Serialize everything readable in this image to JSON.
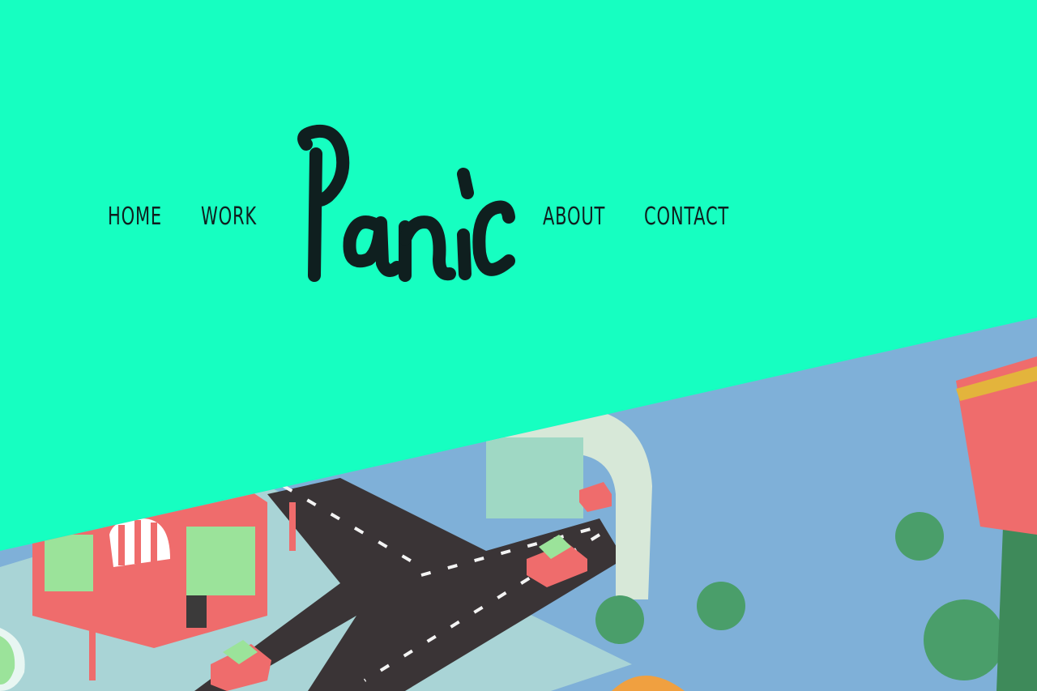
{
  "nav": {
    "items": [
      {
        "label": "HOME"
      },
      {
        "label": "WORK"
      },
      {
        "label": "ABOUT"
      },
      {
        "label": "CONTACT"
      }
    ]
  },
  "logo": {
    "text": "Panic"
  },
  "colors": {
    "background": "#16ffc1",
    "text": "#0f1f1f",
    "road": "#3a3436",
    "ground": "#7fb0d8",
    "building": "#ef6c6c",
    "tree": "#4a9e6a"
  },
  "hero": {
    "content": "isometric-city-illustration"
  }
}
